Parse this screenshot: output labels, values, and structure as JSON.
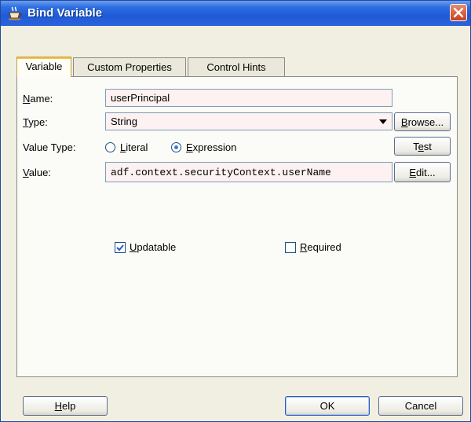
{
  "window": {
    "title": "Bind Variable"
  },
  "tabs": [
    {
      "label": "Variable",
      "active": true
    },
    {
      "label": "Custom Properties",
      "active": false
    },
    {
      "label": "Control Hints",
      "active": false
    }
  ],
  "form": {
    "name": {
      "label_u": "N",
      "label_rest": "ame:",
      "value": "userPrincipal"
    },
    "type": {
      "label_u": "T",
      "label_rest": "ype:",
      "value": "String",
      "browse_u": "B",
      "browse_rest": "rowse..."
    },
    "value_type": {
      "label": "Value Type:",
      "literal_u": "L",
      "literal_rest": "iteral",
      "literal_selected": false,
      "expression_u": "E",
      "expression_rest": "xpression",
      "expression_selected": true,
      "test_pre": "T",
      "test_u": "e",
      "test_rest": "st"
    },
    "value": {
      "label_u": "V",
      "label_rest": "alue:",
      "value": "adf.context.securityContext.userName",
      "edit_u": "E",
      "edit_rest": "dit..."
    },
    "updatable": {
      "label_u": "U",
      "label_rest": "pdatable",
      "checked": true
    },
    "required": {
      "label_u": "R",
      "label_rest": "equired",
      "checked": false
    }
  },
  "footer": {
    "help_u": "H",
    "help_rest": "elp",
    "ok": "OK",
    "cancel": "Cancel"
  },
  "colors": {
    "titlebar": "#1f5ad6",
    "field_bg": "#fdf1f1",
    "active_tab_accent": "#f3c34a"
  },
  "icons": {
    "title": "coffee-cup-icon",
    "close": "close-icon",
    "dropdown": "chevron-down-icon",
    "check": "checkmark-icon"
  }
}
